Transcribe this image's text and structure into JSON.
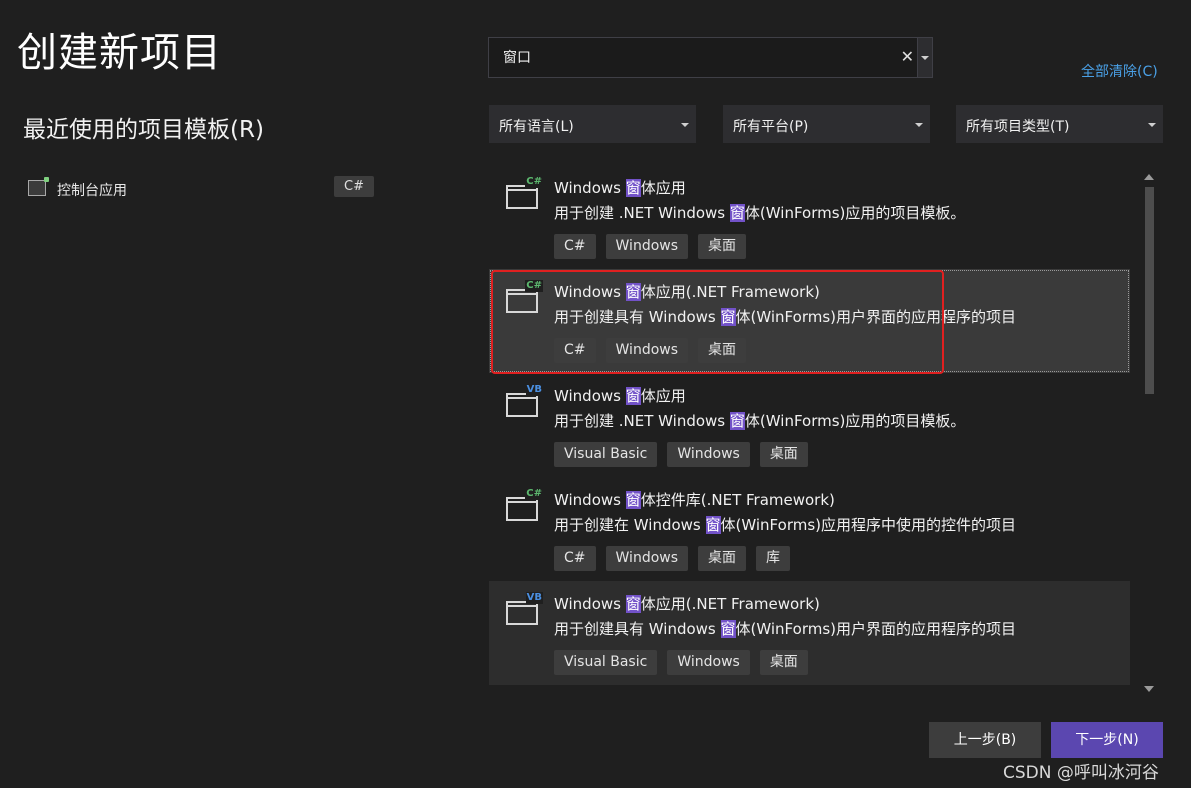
{
  "page": {
    "title": "创建新项目"
  },
  "recent": {
    "title": "最近使用的项目模板(R)",
    "items": [
      {
        "label": "控制台应用",
        "tag": "C#"
      }
    ]
  },
  "search": {
    "value": "窗口",
    "clear_glyph": "✕"
  },
  "clear_all": "全部清除(C)",
  "filters": {
    "language": "所有语言(L)",
    "platform": "所有平台(P)",
    "type": "所有项目类型(T)"
  },
  "templates": [
    {
      "lang": "C#",
      "name_a": "Windows ",
      "hl": "窗",
      "name_b": "体应用",
      "desc_a": "用于创建 .NET Windows ",
      "desc_b": "体(WinForms)应用的项目模板。",
      "tags": [
        "C#",
        "Windows",
        "桌面"
      ]
    },
    {
      "lang": "C#",
      "name_a": "Windows ",
      "hl": "窗",
      "name_b": "体应用(.NET Framework)",
      "desc_a": "用于创建具有 Windows ",
      "desc_b": "体(WinForms)用户界面的应用程序的项目",
      "tags": [
        "C#",
        "Windows",
        "桌面"
      ]
    },
    {
      "lang": "VB",
      "name_a": "Windows ",
      "hl": "窗",
      "name_b": "体应用",
      "desc_a": "用于创建 .NET Windows ",
      "desc_b": "体(WinForms)应用的项目模板。",
      "tags": [
        "Visual Basic",
        "Windows",
        "桌面"
      ]
    },
    {
      "lang": "C#",
      "name_a": "Windows ",
      "hl": "窗",
      "name_b": "体控件库(.NET Framework)",
      "desc_a": "用于创建在 Windows ",
      "desc_b": "体(WinForms)应用程序中使用的控件的项目",
      "tags": [
        "C#",
        "Windows",
        "桌面",
        "库"
      ]
    },
    {
      "lang": "VB",
      "name_a": "Windows ",
      "hl": "窗",
      "name_b": "体应用(.NET Framework)",
      "desc_a": "用于创建具有 Windows ",
      "desc_b": "体(WinForms)用户界面的应用程序的项目",
      "tags": [
        "Visual Basic",
        "Windows",
        "桌面"
      ]
    }
  ],
  "buttons": {
    "back": "上一步(B)",
    "next": "下一步(N)"
  },
  "watermark": "CSDN @呼叫冰河谷",
  "colors": {
    "highlight": "#7252c8",
    "annotation_box": "#e02020",
    "primary_button": "#5b47b0",
    "link": "#4aa0e6"
  }
}
